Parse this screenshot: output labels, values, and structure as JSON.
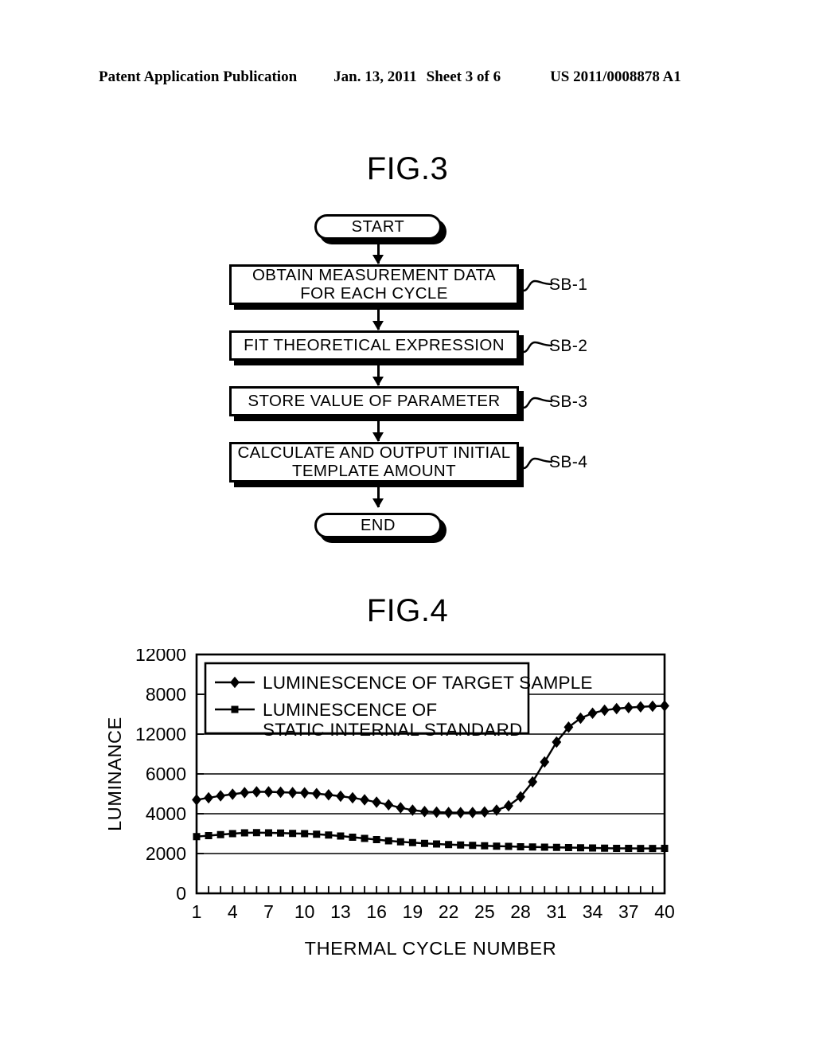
{
  "header": {
    "publication": "Patent Application Publication",
    "date": "Jan. 13, 2011",
    "sheet": "Sheet 3 of 6",
    "patent_number": "US 2011/0008878 A1"
  },
  "figures": {
    "fig3": {
      "title": "FIG.3",
      "nodes": [
        {
          "id": "start",
          "type": "terminator",
          "label": "START",
          "step": ""
        },
        {
          "id": "sb1",
          "type": "process",
          "label": "OBTAIN MEASUREMENT DATA\nFOR EACH CYCLE",
          "step": "SB-1"
        },
        {
          "id": "sb2",
          "type": "process",
          "label": "FIT THEORETICAL EXPRESSION",
          "step": "SB-2"
        },
        {
          "id": "sb3",
          "type": "process",
          "label": "STORE VALUE OF PARAMETER",
          "step": "SB-3"
        },
        {
          "id": "sb4",
          "type": "process",
          "label": "CALCULATE AND OUTPUT INITIAL\nTEMPLATE AMOUNT",
          "step": "SB-4"
        },
        {
          "id": "end",
          "type": "terminator",
          "label": "END",
          "step": ""
        }
      ],
      "node_labels": {
        "start": "START",
        "sb1_line1": "OBTAIN MEASUREMENT DATA",
        "sb1_line2": "FOR EACH CYCLE",
        "sb2": "FIT THEORETICAL EXPRESSION",
        "sb3": "STORE VALUE OF PARAMETER",
        "sb4_line1": "CALCULATE AND OUTPUT INITIAL",
        "sb4_line2": "TEMPLATE AMOUNT",
        "end": "END"
      },
      "step_labels": {
        "sb1": "SB-1",
        "sb2": "SB-2",
        "sb3": "SB-3",
        "sb4": "SB-4"
      }
    },
    "fig4": {
      "title": "FIG.4"
    }
  },
  "chart_data": {
    "type": "line",
    "title": "FIG.4",
    "xlabel": "THERMAL CYCLE NUMBER",
    "ylabel": "LUMINANCE",
    "grid": true,
    "legend_position": "top-left-inside",
    "x_tick_labels": [
      "1",
      "4",
      "7",
      "10",
      "13",
      "16",
      "19",
      "22",
      "25",
      "28",
      "31",
      "34",
      "37",
      "40"
    ],
    "x_tick_values": [
      1,
      4,
      7,
      10,
      13,
      16,
      19,
      22,
      25,
      28,
      31,
      34,
      37,
      40
    ],
    "xlim": [
      1,
      40
    ],
    "y_tick_labels": [
      "12000",
      "8000",
      "12000",
      "6000",
      "4000",
      "2000",
      "0"
    ],
    "y_tick_values": [
      12000,
      10000,
      8000,
      6000,
      4000,
      2000,
      0
    ],
    "ylim": [
      0,
      12000
    ],
    "x": [
      1,
      2,
      3,
      4,
      5,
      6,
      7,
      8,
      9,
      10,
      11,
      12,
      13,
      14,
      15,
      16,
      17,
      18,
      19,
      20,
      21,
      22,
      23,
      24,
      25,
      26,
      27,
      28,
      29,
      30,
      31,
      32,
      33,
      34,
      35,
      36,
      37,
      38,
      39,
      40
    ],
    "series": [
      {
        "name": "LUMINESCENCE OF TARGET SAMPLE",
        "marker": "diamond",
        "values": [
          4700,
          4800,
          4900,
          4980,
          5060,
          5100,
          5100,
          5080,
          5060,
          5050,
          5010,
          4950,
          4880,
          4800,
          4700,
          4580,
          4450,
          4300,
          4180,
          4110,
          4080,
          4060,
          4055,
          4060,
          4090,
          4180,
          4400,
          4850,
          5600,
          6600,
          7600,
          8350,
          8800,
          9050,
          9200,
          9280,
          9330,
          9370,
          9400,
          9420
        ]
      },
      {
        "name": "LUMINESCENCE OF\nSTATIC INTERNAL STANDARD",
        "name_line1": "LUMINESCENCE OF",
        "name_line2": "STATIC INTERNAL STANDARD",
        "marker": "square",
        "values": [
          2850,
          2900,
          2950,
          3000,
          3040,
          3050,
          3040,
          3030,
          3010,
          3000,
          2970,
          2930,
          2880,
          2820,
          2760,
          2700,
          2640,
          2590,
          2550,
          2510,
          2480,
          2450,
          2430,
          2410,
          2390,
          2370,
          2360,
          2340,
          2330,
          2320,
          2310,
          2300,
          2290,
          2280,
          2270,
          2260,
          2260,
          2255,
          2255,
          2260
        ]
      }
    ]
  }
}
